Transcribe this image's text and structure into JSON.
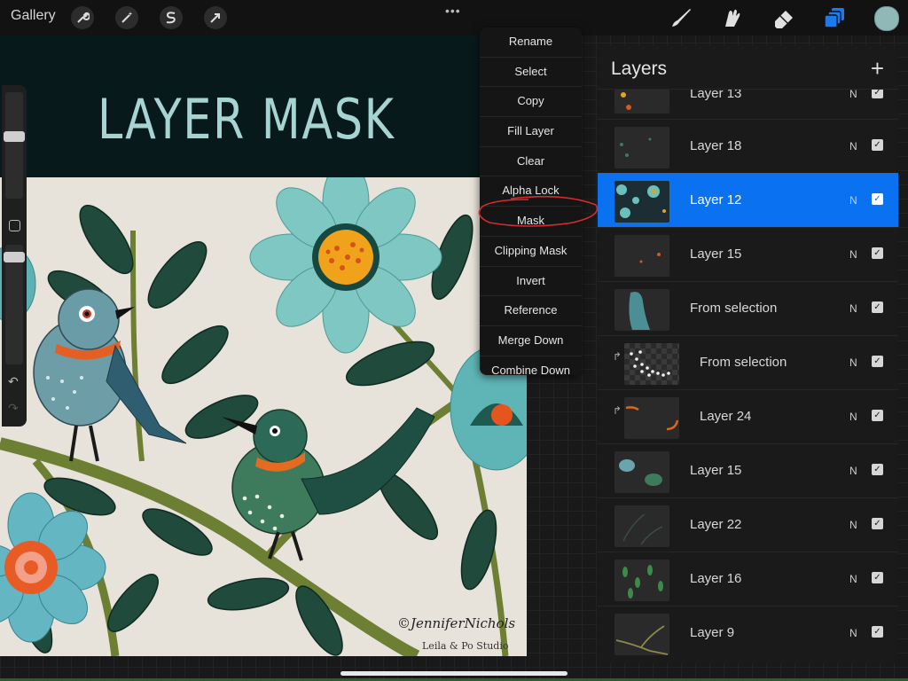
{
  "toolbar": {
    "gallery": "Gallery",
    "left_tools": [
      "wrench-icon",
      "magic-wand-icon",
      "selection-icon",
      "transform-arrow-icon"
    ],
    "more": "•••",
    "right_tools": [
      "brush-icon",
      "smudge-icon",
      "eraser-icon",
      "layers-icon"
    ],
    "active_color": "#8fb8b6",
    "active_tool_color": "#1a7af0"
  },
  "canvas": {
    "title": "LAYER MASK",
    "signature": "©JenniferNichols",
    "studio": "Leila & Po Studio"
  },
  "menu": {
    "items": [
      "Rename",
      "Select",
      "Copy",
      "Fill Layer",
      "Clear",
      "Alpha Lock",
      "Mask",
      "Clipping Mask",
      "Invert",
      "Reference",
      "Merge Down",
      "Combine Down"
    ],
    "highlighted": "Mask"
  },
  "layers": {
    "title": "Layers",
    "add": "+",
    "rows": [
      {
        "name": "Layer 13",
        "blend": "N",
        "visible": true,
        "selected": false,
        "clipped": false
      },
      {
        "name": "Layer 18",
        "blend": "N",
        "visible": true,
        "selected": false,
        "clipped": false
      },
      {
        "name": "Layer 12",
        "blend": "N",
        "visible": true,
        "selected": true,
        "clipped": false
      },
      {
        "name": "Layer 15",
        "blend": "N",
        "visible": true,
        "selected": false,
        "clipped": false
      },
      {
        "name": "From selection",
        "blend": "N",
        "visible": true,
        "selected": false,
        "clipped": false
      },
      {
        "name": "From selection",
        "blend": "N",
        "visible": true,
        "selected": false,
        "clipped": true
      },
      {
        "name": "Layer 24",
        "blend": "N",
        "visible": true,
        "selected": false,
        "clipped": true
      },
      {
        "name": "Layer 15",
        "blend": "N",
        "visible": true,
        "selected": false,
        "clipped": false
      },
      {
        "name": "Layer 22",
        "blend": "N",
        "visible": true,
        "selected": false,
        "clipped": false
      },
      {
        "name": "Layer 16",
        "blend": "N",
        "visible": true,
        "selected": false,
        "clipped": false
      },
      {
        "name": "Layer 9",
        "blend": "N",
        "visible": true,
        "selected": false,
        "clipped": false
      }
    ]
  },
  "colors": {
    "accent": "#0a72f0",
    "canvas_header": "#08191c",
    "title_text": "#a6d4d2",
    "paper": "#e7e3da"
  }
}
